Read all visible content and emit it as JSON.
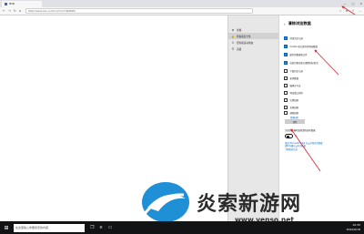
{
  "browser": {
    "tab_title": "MSN",
    "url": "https://www.msn.cn/zh-cn/?ocid=BeMsftp",
    "nav": {
      "back": "←",
      "forward": "→",
      "refresh": "↻",
      "home": "⌂"
    },
    "window_controls": {
      "minimize": "—",
      "maximize": "□",
      "close": "✕"
    },
    "toolbar_icons": [
      "favorite-icon",
      "reading-list-icon",
      "share-icon",
      "more-icon"
    ]
  },
  "sidebar": {
    "items": [
      {
        "label": "常规",
        "icon": "gear-icon",
        "active": false
      },
      {
        "label": "隐私和安全性",
        "icon": "lock-icon",
        "active": true
      },
      {
        "label": "密码和自动填充",
        "icon": "key-icon",
        "active": false
      },
      {
        "label": "高级",
        "icon": "sliders-icon",
        "active": false
      }
    ]
  },
  "panel": {
    "title": "清除浏览数据",
    "options": [
      {
        "label": "浏览历史记录",
        "checked": true
      },
      {
        "label": "Cookie 和已保存的网站数据",
        "checked": true
      },
      {
        "label": "缓存的数据和文件",
        "checked": true
      },
      {
        "label": "标签页预览和已搁置的标签页",
        "checked": true
      },
      {
        "label": "下载历史记录",
        "checked": false
      },
      {
        "label": "表单数据",
        "checked": false
      },
      {
        "label": "媒体许可证",
        "checked": false
      },
      {
        "label": "弹出窗口例外",
        "checked": false
      },
      {
        "label": "位置权限",
        "checked": false
      },
      {
        "label": "全屏权限",
        "checked": false
      },
      {
        "label": "通知权限",
        "checked": false
      }
    ],
    "manage_link": "管理权限",
    "clear_button": "清除",
    "toggle_label": "关闭浏览器时始终清除这些数据",
    "toggle_state": "关",
    "links": [
      "更改 Microsoft Edge 在云中保存的数据",
      "清除存储在云中的数据",
      "了解更多信息"
    ]
  },
  "watermark": {
    "title": "炎索新游网",
    "url": "www.yenso.net"
  },
  "taskbar": {
    "search_placeholder": "在这里输入你要搜索的内容",
    "time": "10:35",
    "date": "2020/6/18"
  },
  "colors": {
    "accent": "#0067c0",
    "annotation": "#e0202a",
    "taskbar": "#111315"
  }
}
